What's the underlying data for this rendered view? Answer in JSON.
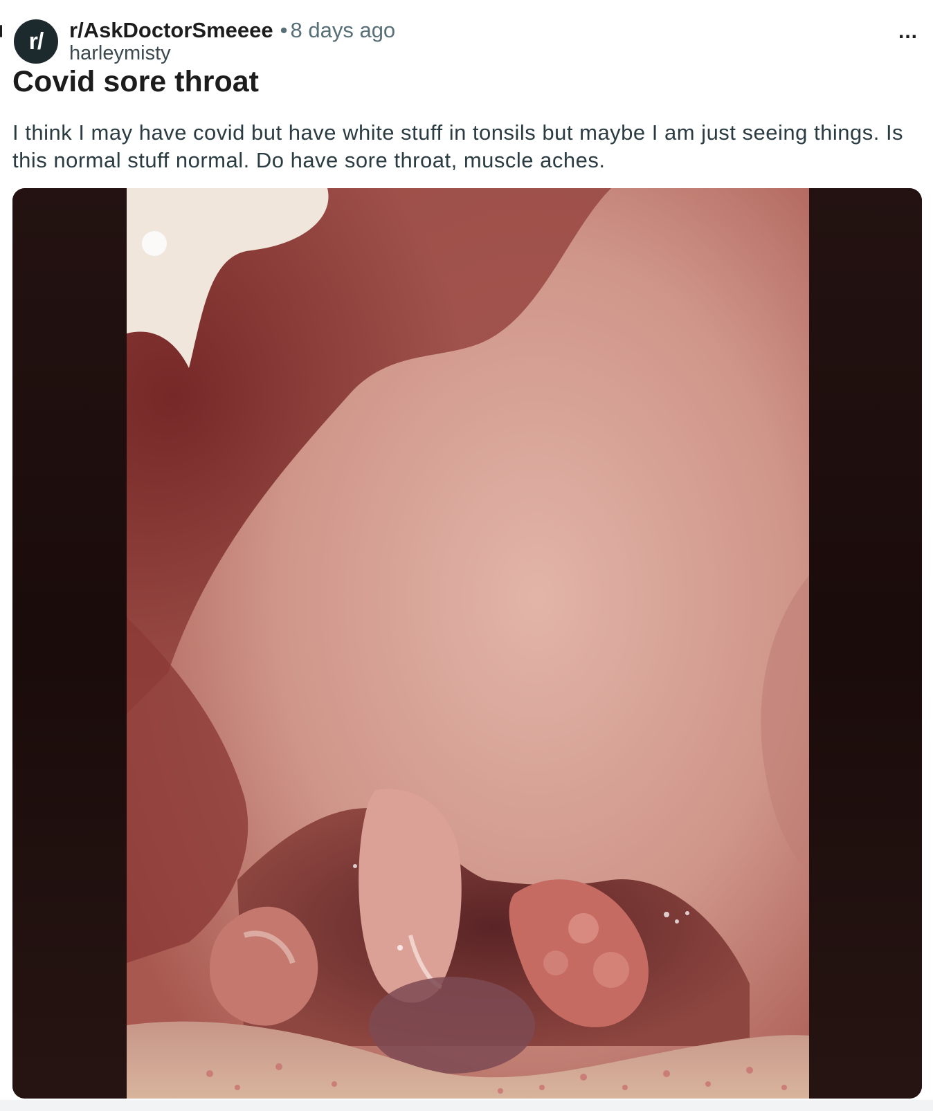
{
  "post": {
    "subreddit": "r/AskDoctorSmeeee",
    "separator": "•",
    "time_ago": "8 days ago",
    "username": "harleymisty",
    "avatar_text": "r/",
    "overflow_label": "...",
    "title": "Covid sore throat",
    "body": "I think I may have covid but have white stuff in tonsils but maybe I am just seeing things. Is this normal stuff normal. Do have sore throat, muscle aches."
  },
  "media": {
    "icon": "throat-photo",
    "colors": {
      "frame": "#1f100e",
      "tissue": "#c98a80",
      "palate": "#d9a79c",
      "shadow": "#7a2e2a"
    }
  }
}
